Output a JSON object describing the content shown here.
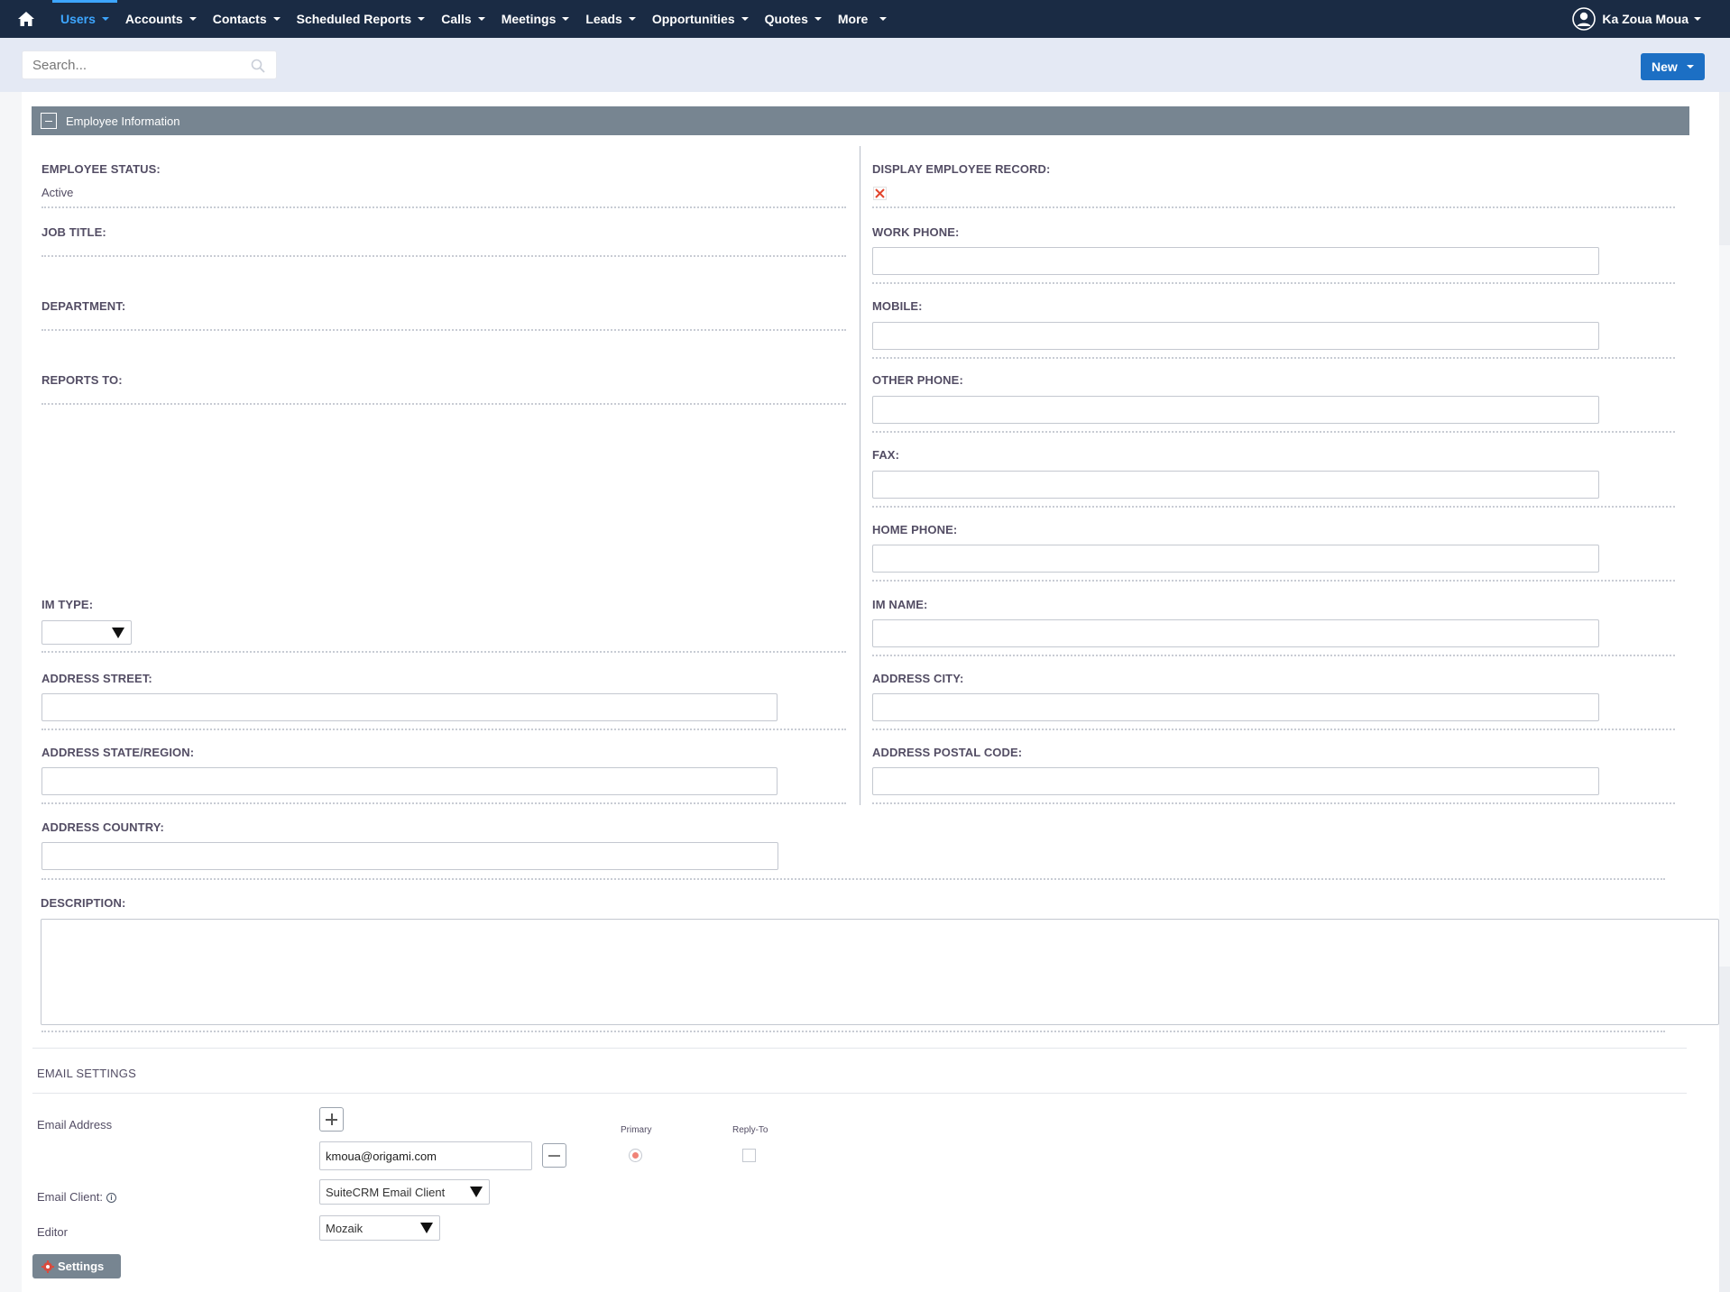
{
  "nav": {
    "items": [
      {
        "label": "Users",
        "active": true
      },
      {
        "label": "Accounts"
      },
      {
        "label": "Contacts"
      },
      {
        "label": "Scheduled Reports"
      },
      {
        "label": "Calls"
      },
      {
        "label": "Meetings"
      },
      {
        "label": "Leads"
      },
      {
        "label": "Opportunities"
      },
      {
        "label": "Quotes"
      },
      {
        "label": "More"
      }
    ],
    "user_name": "Ka Zoua Moua"
  },
  "search": {
    "placeholder": "Search..."
  },
  "new_button": {
    "label": "New"
  },
  "panel": {
    "title": "Employee Information"
  },
  "fields": {
    "employee_status": {
      "label": "EMPLOYEE STATUS:",
      "value": "Active"
    },
    "display_employee_record": {
      "label": "DISPLAY EMPLOYEE RECORD:",
      "checked": false
    },
    "job_title": {
      "label": "JOB TITLE:"
    },
    "work_phone": {
      "label": "WORK PHONE:",
      "value": ""
    },
    "department": {
      "label": "DEPARTMENT:"
    },
    "mobile": {
      "label": "MOBILE:",
      "value": ""
    },
    "reports_to": {
      "label": "REPORTS TO:"
    },
    "other_phone": {
      "label": "OTHER PHONE:",
      "value": ""
    },
    "fax": {
      "label": "FAX:",
      "value": ""
    },
    "home_phone": {
      "label": "HOME PHONE:",
      "value": ""
    },
    "im_type": {
      "label": "IM TYPE:",
      "value": ""
    },
    "im_name": {
      "label": "IM NAME:",
      "value": ""
    },
    "address_street": {
      "label": "ADDRESS STREET:",
      "value": ""
    },
    "address_city": {
      "label": "ADDRESS CITY:",
      "value": ""
    },
    "address_state": {
      "label": "ADDRESS STATE/REGION:",
      "value": ""
    },
    "address_postal_code": {
      "label": "ADDRESS POSTAL CODE:",
      "value": ""
    },
    "address_country": {
      "label": "ADDRESS COUNTRY:",
      "value": ""
    },
    "description": {
      "label": "DESCRIPTION:",
      "value": ""
    }
  },
  "email_settings": {
    "title": "EMAIL SETTINGS",
    "email_address_label": "Email Address",
    "primary_label": "Primary",
    "reply_to_label": "Reply-To",
    "email_value": "kmoua@origami.com",
    "primary_selected": true,
    "reply_to_checked": false,
    "email_client_label": "Email Client:",
    "email_client_value": "SuiteCRM Email Client",
    "editor_label": "Editor",
    "editor_value": "Mozaik",
    "settings_button": "Settings"
  },
  "colors": {
    "topnav_bg": "#1a2b44",
    "active_nav": "#3da6ff",
    "new_button_bg": "#1c6fc4",
    "panel_header_bg": "#778591",
    "radio_selected": "#f08377"
  }
}
